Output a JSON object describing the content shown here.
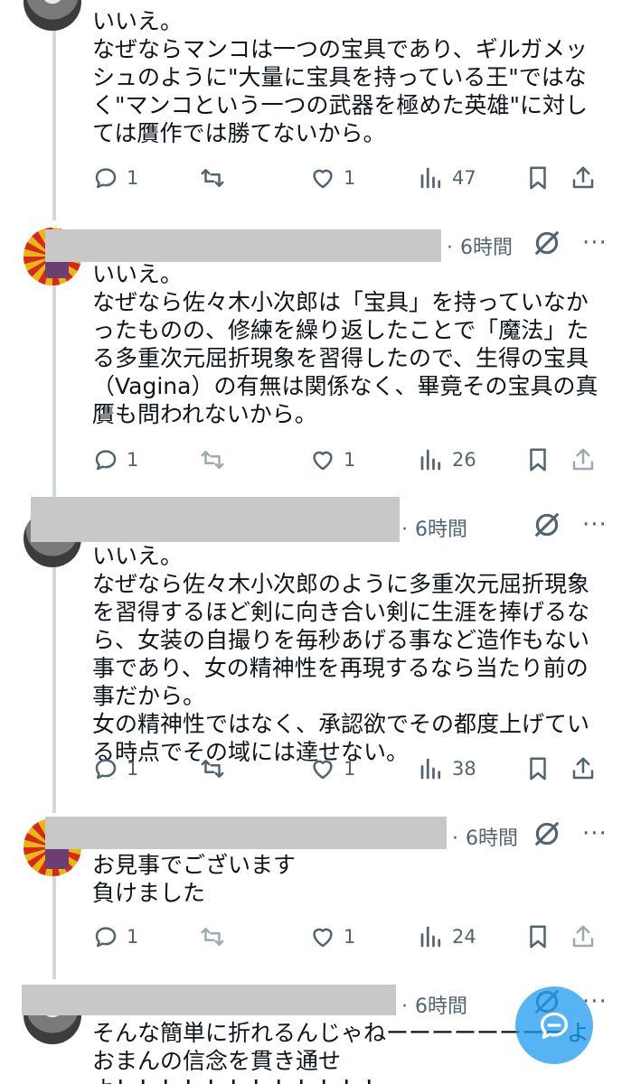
{
  "posts": [
    {
      "text": "いいえ。\nなぜならマンコは一つの宝具であり、ギルガメッシュのように\"大量に宝具を持っている王\"ではなく\"マンコという一つの武器を極めた英雄\"に対しては贋作では勝てないから。",
      "time": "",
      "replies": "1",
      "retweets": "",
      "likes": "1",
      "views": "47"
    },
    {
      "text": "いいえ。\nなぜなら佐々木小次郎は「宝具」を持っていなかったものの、修練を繰り返したことで「魔法」たる多重次元屈折現象を習得したので、生得の宝具（Vagina）の有無は関係なく、畢竟その宝具の真贋も問われないから。",
      "time": "6時間",
      "replies": "1",
      "retweets": "",
      "likes": "1",
      "views": "26"
    },
    {
      "text": "いいえ。\nなぜなら佐々木小次郎のように多重次元屈折現象を習得するほど剣に向き合い剣に生涯を捧げるなら、女装の自撮りを毎秒あげる事など造作もない事であり、女の精神性を再現するなら当たり前の事だから。\n女の精神性ではなく、承認欲でその都度上げている時点でその域には達せない。",
      "time": "6時間",
      "replies": "1",
      "retweets": "",
      "likes": "1",
      "views": "38"
    },
    {
      "text": "お見事でございます\n負けました",
      "time": "6時間",
      "replies": "1",
      "retweets": "",
      "likes": "1",
      "views": "24"
    },
    {
      "text": "そんな簡単に折れるんじゃねーーーーーーーーよ\nおまんの信念を貫き通せよ！！！！！！！！！！！！",
      "time": "6時間"
    }
  ],
  "meta_dot": "·",
  "more_label": "···",
  "icons": {
    "reply": "reply-icon",
    "retweet": "retweet-icon",
    "like": "heart-icon",
    "views": "views-icon",
    "bookmark": "bookmark-icon",
    "share": "share-icon",
    "grok": "grok-icon",
    "more": "more-icon",
    "compose": "compose-icon"
  },
  "colors": {
    "text": "#0f1419",
    "secondary": "#536471",
    "accent": "#1d9bf0",
    "thread_line": "#cfd9de",
    "redaction": "#c8c8c8"
  }
}
